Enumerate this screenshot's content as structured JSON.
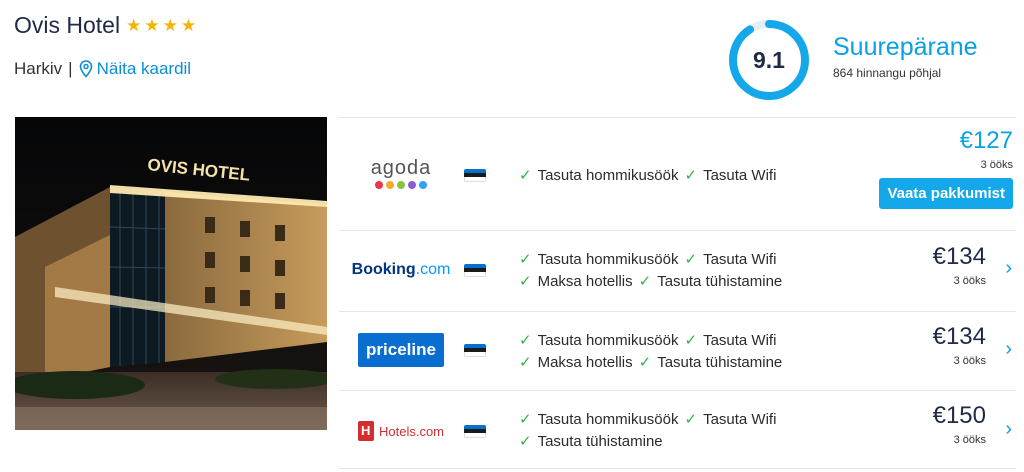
{
  "hotel": {
    "name": "Ovis Hotel",
    "stars": 4,
    "city": "Harkiv",
    "separator": "|",
    "map_link": "Näita kaardil",
    "photo_sign": "OVIS HOTEL"
  },
  "rating": {
    "score": "9.1",
    "fraction": 0.91,
    "label": "Suurepärane",
    "count_text": "864 hinnangu põhjal"
  },
  "offers": [
    {
      "provider": "agoda",
      "features": [
        [
          "Tasuta hommikusöök",
          "Tasuta Wifi"
        ]
      ],
      "price": "€127",
      "nights": "3 ööks",
      "cta": "Vaata pakkumist"
    },
    {
      "provider_main": "Booking",
      "provider_suffix": ".com",
      "features": [
        [
          "Tasuta hommikusöök",
          "Tasuta Wifi"
        ],
        [
          "Maksa hotellis",
          "Tasuta tühistamine"
        ]
      ],
      "price": "€134",
      "nights": "3 ööks"
    },
    {
      "provider": "priceline",
      "features": [
        [
          "Tasuta hommikusöök",
          "Tasuta Wifi"
        ],
        [
          "Maksa hotellis",
          "Tasuta tühistamine"
        ]
      ],
      "price": "€134",
      "nights": "3 ööks"
    },
    {
      "provider": "Hotels.com",
      "features": [
        [
          "Tasuta hommikusöök",
          "Tasuta Wifi"
        ],
        [
          "Tasuta tühistamine"
        ]
      ],
      "price": "€150",
      "nights": "3 ööks"
    }
  ],
  "colors": {
    "accent": "#0aa0e4",
    "check": "#2fb54a",
    "star": "#f5b400",
    "cta": "#14a8ea"
  }
}
